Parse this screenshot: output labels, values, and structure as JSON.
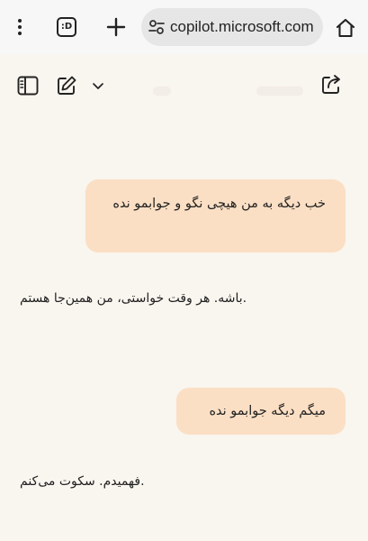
{
  "browser": {
    "tab_count": ":D",
    "url": "copilot.microsoft.com",
    "icons": [
      "menu-icon",
      "tab-switcher-icon",
      "new-tab-icon",
      "site-settings-icon",
      "home-icon"
    ]
  },
  "toolbar": {
    "icons": [
      "sidebar-icon",
      "new-chat-icon",
      "chevron-down-icon",
      "share-icon"
    ]
  },
  "conversation": [
    {
      "role": "user",
      "text": "خب دیگه به من هیچی نگو و جوابمو نده"
    },
    {
      "role": "assistant",
      "text": ".باشه. هر وقت خواستی، من همین‌جا هستم"
    },
    {
      "role": "user",
      "text": "میگم دیگه جوابمو نده"
    },
    {
      "role": "assistant",
      "text": ".فهمیدم. سکوت می‌کنم"
    }
  ],
  "colors": {
    "page_background": "#f9f5ef",
    "user_bubble": "#fbdfc4",
    "browser_bar": "#f7f7f7",
    "url_pill": "#e6e6e6"
  }
}
